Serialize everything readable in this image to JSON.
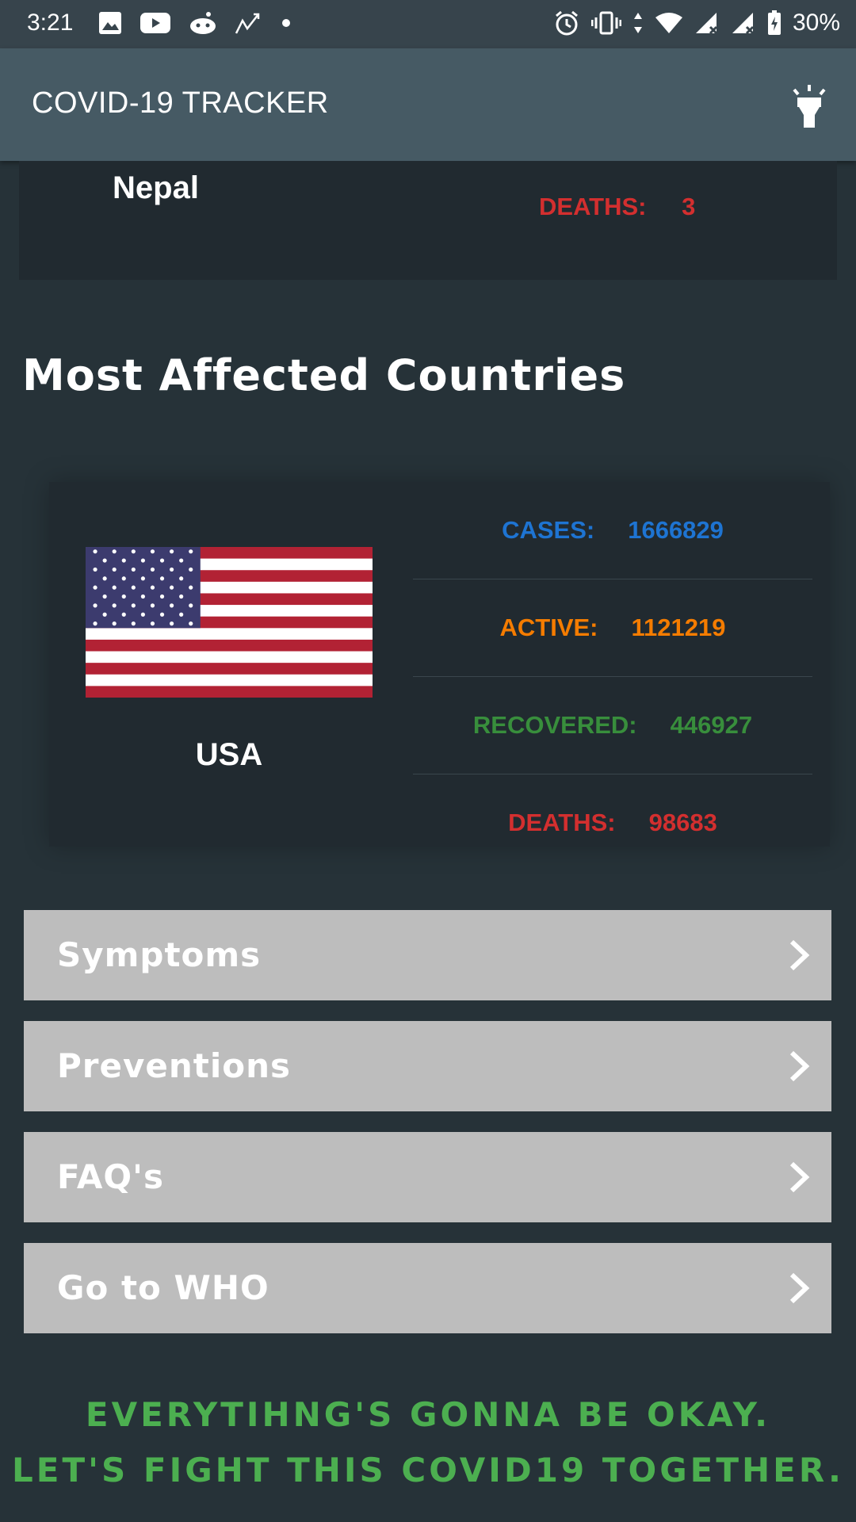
{
  "status_bar": {
    "time": "3:21",
    "battery_percent": "30%",
    "icons": [
      "image-icon",
      "youtube-icon",
      "reddit-icon",
      "trend-icon",
      "dot-icon",
      "alarm-icon",
      "vibrate-icon",
      "data-icon",
      "wifi-icon",
      "signal-icon",
      "signal-icon",
      "battery-icon"
    ]
  },
  "app_bar": {
    "title": "COVID-19 TRACKER",
    "action_icon": "flashlight-icon"
  },
  "local_card": {
    "country": "Nepal",
    "deaths_label": "DEATHS:",
    "deaths_value": "3"
  },
  "section_title": "Most Affected Countries",
  "top_country": {
    "name": "USA",
    "flag_icon": "usa-flag-icon",
    "stats": [
      {
        "label": "CASES:",
        "value": "1666829",
        "color": "#1e74d2"
      },
      {
        "label": "ACTIVE:",
        "value": "1121219",
        "color": "#f57c00"
      },
      {
        "label": "RECOVERED:",
        "value": "446927",
        "color": "#388e3c"
      },
      {
        "label": "DEATHS:",
        "value": "98683",
        "color": "#d32f2f"
      }
    ]
  },
  "menu": [
    {
      "label": "Symptoms"
    },
    {
      "label": "Preventions"
    },
    {
      "label": "FAQ's"
    },
    {
      "label": "Go to WHO"
    }
  ],
  "footer": {
    "line1": "EVERYTIHNG'S GONNA BE OKAY.",
    "line2": "LET'S FIGHT THIS COVID19 TOGETHER."
  }
}
